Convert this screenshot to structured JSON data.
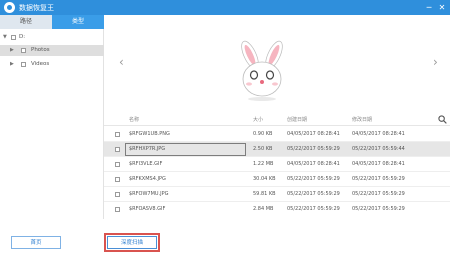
{
  "app": {
    "title": "数据恢复王"
  },
  "window_controls": {
    "minimize": "─",
    "close": "✕"
  },
  "tabs": [
    {
      "label": "路径"
    },
    {
      "label": "类型"
    }
  ],
  "tree": {
    "root": {
      "label": "D:"
    },
    "items": [
      {
        "label": "Photos"
      },
      {
        "label": "Videos"
      }
    ]
  },
  "preview": {
    "prev": "‹",
    "next": "›"
  },
  "table": {
    "headers": [
      "名称",
      "大小",
      "创建日期",
      "修改日期"
    ],
    "rows": [
      {
        "name": "$RFGW1UB.PNG",
        "size": "0.90 KB",
        "created": "04/05/2017 08:28:41",
        "modified": "04/05/2017 08:28:41"
      },
      {
        "name": "$RFHXP7R.JPG",
        "size": "2.50 KB",
        "created": "05/22/2017 05:59:29",
        "modified": "05/22/2017 05:59:44"
      },
      {
        "name": "$RFI3VLE.GIF",
        "size": "1.22 MB",
        "created": "04/05/2017 08:28:41",
        "modified": "04/05/2017 08:28:41"
      },
      {
        "name": "$RFKXMS4.JPG",
        "size": "30.04 KB",
        "created": "05/22/2017 05:59:29",
        "modified": "05/22/2017 05:59:29"
      },
      {
        "name": "$RFOW7MU.JPG",
        "size": "59.81 KB",
        "created": "05/22/2017 05:59:29",
        "modified": "05/22/2017 05:59:29"
      },
      {
        "name": "$RFOASV8.GIF",
        "size": "2.84 MB",
        "created": "05/22/2017 05:59:29",
        "modified": "05/22/2017 05:59:29"
      }
    ]
  },
  "footer": {
    "home": "首页",
    "deep_scan": "深度扫描"
  },
  "colors": {
    "titlebar": "#2f8fdc",
    "tab_active": "#3a9de8",
    "highlight": "#d9534f"
  }
}
